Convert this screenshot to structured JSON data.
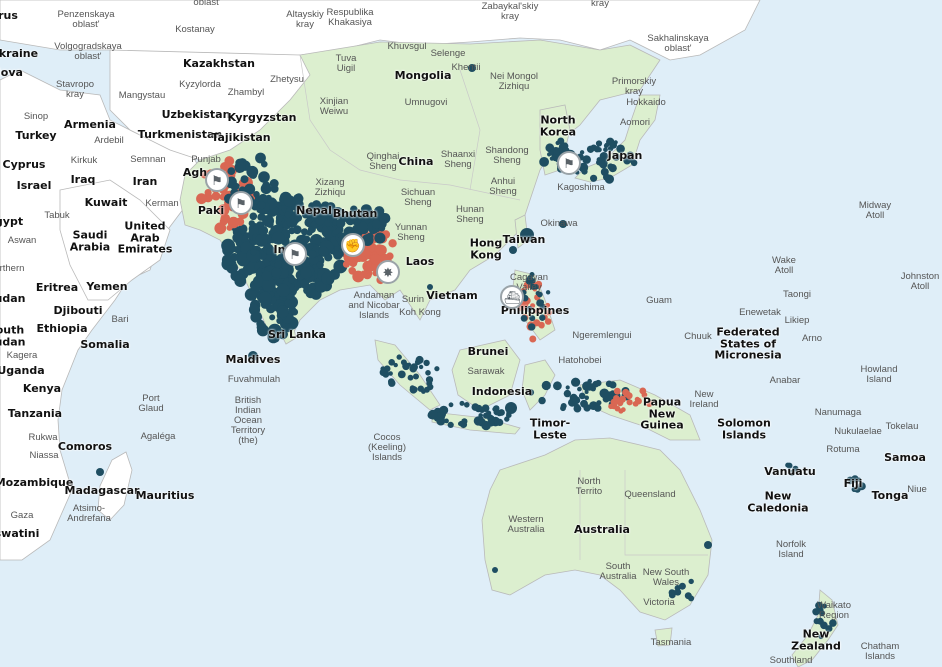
{
  "colors": {
    "ocean": "#dfeef8",
    "land_highlight": "#dcefcf",
    "land_other": "#ffffff",
    "border": "#b9b9b9",
    "event_blue": "#1f4e62",
    "event_red": "#d96753",
    "marker_border": "#9aa3a8"
  },
  "country_labels": [
    {
      "id": "russia-w",
      "text": "rus"
    },
    {
      "id": "ukraine",
      "text": "Ukraine"
    },
    {
      "id": "moldova",
      "text": "lova"
    },
    {
      "id": "kazakhstan",
      "text": "Kazakhstan"
    },
    {
      "id": "mongolia",
      "text": "Mongolia"
    },
    {
      "id": "armenia",
      "text": "Armenia"
    },
    {
      "id": "turkey",
      "text": "Turkey"
    },
    {
      "id": "cyprus",
      "text": "Cyprus"
    },
    {
      "id": "turkmenistan",
      "text": "Turkmenistan"
    },
    {
      "id": "uzbekistan",
      "text": "Uzbekistan"
    },
    {
      "id": "kyrgyzstan",
      "text": "Kyrgyzstan"
    },
    {
      "id": "tajikistan",
      "text": "Tajikistan"
    },
    {
      "id": "north-korea",
      "text": "North\nKorea"
    },
    {
      "id": "japan",
      "text": "Japan"
    },
    {
      "id": "china",
      "text": "China"
    },
    {
      "id": "israel",
      "text": "Israel"
    },
    {
      "id": "iraq",
      "text": "Iraq"
    },
    {
      "id": "iran",
      "text": "Iran"
    },
    {
      "id": "kuwait",
      "text": "Kuwait"
    },
    {
      "id": "egypt",
      "text": "gypt"
    },
    {
      "id": "saudi-arabia",
      "text": "Saudi\nArabia"
    },
    {
      "id": "uae",
      "text": "United\nArab\nEmirates"
    },
    {
      "id": "afghanistan",
      "text": "Agh"
    },
    {
      "id": "pakistan",
      "text": "Paki"
    },
    {
      "id": "nepal",
      "text": "Nepal"
    },
    {
      "id": "bhutan",
      "text": "Bhutan"
    },
    {
      "id": "india",
      "text": "India"
    },
    {
      "id": "taiwan",
      "text": "Taiwan"
    },
    {
      "id": "hong-kong",
      "text": "Hong\nKong"
    },
    {
      "id": "laos",
      "text": "Laos"
    },
    {
      "id": "vietnam",
      "text": "Vietnam"
    },
    {
      "id": "philippines",
      "text": "Philippines"
    },
    {
      "id": "eritrea",
      "text": "Eritrea"
    },
    {
      "id": "yemen",
      "text": "Yemen"
    },
    {
      "id": "djibouti",
      "text": "Djibouti"
    },
    {
      "id": "sudan",
      "text": "udan"
    },
    {
      "id": "south-sudan",
      "text": "outh\nudan"
    },
    {
      "id": "ethiopia",
      "text": "Ethiopia"
    },
    {
      "id": "somalia",
      "text": "Somalia"
    },
    {
      "id": "sri-lanka",
      "text": "Sri Lanka"
    },
    {
      "id": "maldives",
      "text": "Maldives"
    },
    {
      "id": "uganda",
      "text": "Uganda"
    },
    {
      "id": "kenya",
      "text": "Kenya"
    },
    {
      "id": "tanzania",
      "text": "Tanzania"
    },
    {
      "id": "brunei",
      "text": "Brunei"
    },
    {
      "id": "indonesia",
      "text": "Indonesia"
    },
    {
      "id": "timor-leste",
      "text": "Timor-\nLeste"
    },
    {
      "id": "papua-new-guinea",
      "text": "Papua\nNew\nGuinea"
    },
    {
      "id": "solomon-islands",
      "text": "Solomon\nIslands"
    },
    {
      "id": "micronesia",
      "text": "Federated\nStates of\nMicronesia"
    },
    {
      "id": "comoros",
      "text": "Comoros"
    },
    {
      "id": "mozambique",
      "text": "Mozambique"
    },
    {
      "id": "madagascar",
      "text": "Madagascar"
    },
    {
      "id": "mauritius",
      "text": "Mauritius"
    },
    {
      "id": "eswatini",
      "text": "swatini"
    },
    {
      "id": "australia",
      "text": "Australia"
    },
    {
      "id": "vanuatu",
      "text": "Vanuatu"
    },
    {
      "id": "fiji",
      "text": "Fiji"
    },
    {
      "id": "samoa",
      "text": "Samoa"
    },
    {
      "id": "tonga",
      "text": "Tonga"
    },
    {
      "id": "new-caledonia",
      "text": "New\nCaledonia"
    },
    {
      "id": "new-zealand",
      "text": "New\nZealand"
    }
  ],
  "region_labels": [
    {
      "id": "penzenskaya",
      "text": "Penzenskaya\noblast'"
    },
    {
      "id": "oblast-top",
      "text": "oblast'"
    },
    {
      "id": "altayskiy",
      "text": "Altayskiy\nkray"
    },
    {
      "id": "khakasiya",
      "text": "Respublika\nKhakasiya"
    },
    {
      "id": "zabaykalskiy",
      "text": "Zabaykal'skiy\nkray"
    },
    {
      "id": "kray-top",
      "text": "kray"
    },
    {
      "id": "sakhalinskaya",
      "text": "Sakhalinskaya\noblast'"
    },
    {
      "id": "volgogradskaya",
      "text": "Volgogradskaya\noblast'"
    },
    {
      "id": "kostanay",
      "text": "Kostanay"
    },
    {
      "id": "tuva",
      "text": "Tuva\nUigil"
    },
    {
      "id": "khuvsgul",
      "text": "Khuvsgul"
    },
    {
      "id": "selenge",
      "text": "Selenge"
    },
    {
      "id": "khentii",
      "text": "Khentii"
    },
    {
      "id": "nei-mongol",
      "text": "Nei Mongol\nZizhiqu"
    },
    {
      "id": "primorskiy",
      "text": "Primorskiy\nkray"
    },
    {
      "id": "stavropol",
      "text": "Stavropo\nkray"
    },
    {
      "id": "mangystau",
      "text": "Mangystau"
    },
    {
      "id": "kyzylorda",
      "text": "Kyzylorda"
    },
    {
      "id": "zhambyl",
      "text": "Zhambyl"
    },
    {
      "id": "zhetysu",
      "text": "Zhetysu"
    },
    {
      "id": "xinjiang",
      "text": "Xinjian\nWeiwu"
    },
    {
      "id": "umnugovi",
      "text": "Umnugovi"
    },
    {
      "id": "hokkaido",
      "text": "Hokkaido"
    },
    {
      "id": "aomori",
      "text": "Aomori"
    },
    {
      "id": "ardebil",
      "text": "Ardebil"
    },
    {
      "id": "sinop",
      "text": "Sinop"
    },
    {
      "id": "kirkuk",
      "text": "Kirkuk"
    },
    {
      "id": "semnan",
      "text": "Semnan"
    },
    {
      "id": "qinghai",
      "text": "Qinghai\nSheng"
    },
    {
      "id": "shaanxi",
      "text": "Shaanxi\nSheng"
    },
    {
      "id": "shandong",
      "text": "Shandong\nSheng"
    },
    {
      "id": "anhui",
      "text": "Anhui\nSheng"
    },
    {
      "id": "xizang",
      "text": "Xizang\nZizhiqu"
    },
    {
      "id": "sichuan",
      "text": "Sichuan\nSheng"
    },
    {
      "id": "hunan",
      "text": "Hunan\nSheng"
    },
    {
      "id": "yunnan",
      "text": "Yunnan\nSheng"
    },
    {
      "id": "kerman",
      "text": "Kerman"
    },
    {
      "id": "tabuk",
      "text": "Tabuk"
    },
    {
      "id": "aswan",
      "text": "Aswan"
    },
    {
      "id": "kagoshima",
      "text": "Kagoshima"
    },
    {
      "id": "okinawa",
      "text": "Okinawa"
    },
    {
      "id": "cagayan",
      "text": "Cagayan\nValley"
    },
    {
      "id": "andaman",
      "text": "Andaman\nand Nicobar\nIslands"
    },
    {
      "id": "northern",
      "text": "rthern"
    },
    {
      "id": "bari",
      "text": "Bari"
    },
    {
      "id": "ngeremlengui",
      "text": "Ngeremlengui"
    },
    {
      "id": "hatohobei",
      "text": "Hatohobei"
    },
    {
      "id": "fuvahmulah",
      "text": "Fuvahmulah"
    },
    {
      "id": "biot",
      "text": "British\nIndian\nOcean\nTerritory\n(the)"
    },
    {
      "id": "cocos",
      "text": "Cocos\n(Keeling)\nIslands"
    },
    {
      "id": "rukwa",
      "text": "Rukwa"
    },
    {
      "id": "niassa",
      "text": "Niassa"
    },
    {
      "id": "gaza",
      "text": "Gaza"
    },
    {
      "id": "atsimo",
      "text": "Atsimo-\nAndrefana"
    },
    {
      "id": "northern-territory",
      "text": "North\nTerrito"
    },
    {
      "id": "queensland",
      "text": "Queensland"
    },
    {
      "id": "western-australia",
      "text": "Western\nAustralia"
    },
    {
      "id": "south-australia",
      "text": "South\nAustralia"
    },
    {
      "id": "nsw",
      "text": "New South\nWales"
    },
    {
      "id": "victoria",
      "text": "Victoria"
    },
    {
      "id": "tasmania",
      "text": "Tasmania"
    },
    {
      "id": "guam",
      "text": "Guam"
    },
    {
      "id": "midway",
      "text": "Midway\nAtoll"
    },
    {
      "id": "wake",
      "text": "Wake\nAtoll"
    },
    {
      "id": "johnston",
      "text": "Johnston\nAtoll"
    },
    {
      "id": "enewetak",
      "text": "Enewetak"
    },
    {
      "id": "taongi",
      "text": "Taongi"
    },
    {
      "id": "likiep",
      "text": "Likiep"
    },
    {
      "id": "chuuk",
      "text": "Chuuk"
    },
    {
      "id": "arno",
      "text": "Arno"
    },
    {
      "id": "anabar",
      "text": "Anabar"
    },
    {
      "id": "howland",
      "text": "Howland\nIsland"
    },
    {
      "id": "new-ireland",
      "text": "New\nIreland"
    },
    {
      "id": "nanumaga",
      "text": "Nanumaga"
    },
    {
      "id": "nukulaelae",
      "text": "Nukulaelae"
    },
    {
      "id": "tokelau",
      "text": "Tokelau"
    },
    {
      "id": "rotuma",
      "text": "Rotuma"
    },
    {
      "id": "niue",
      "text": "Niue"
    },
    {
      "id": "norfolk",
      "text": "Norfolk\nIsland"
    },
    {
      "id": "waikato",
      "text": "Waikato\nRegion"
    },
    {
      "id": "chatham",
      "text": "Chatham\nIslands"
    },
    {
      "id": "southland",
      "text": "Southland"
    },
    {
      "id": "kagera",
      "text": "Kagera"
    },
    {
      "id": "port-glaud",
      "text": "Port\nGlaud"
    },
    {
      "id": "agalega",
      "text": "Agaléga"
    },
    {
      "id": "sarawak",
      "text": "Sarawak"
    },
    {
      "id": "koh-kong",
      "text": "Koh Kong"
    },
    {
      "id": "surin",
      "text": "Surin"
    },
    {
      "id": "punjab",
      "text": "Punjab"
    }
  ],
  "markers": [
    {
      "id": "cluster-afghanistan",
      "icon": "people-icon",
      "glyph": "⚑"
    },
    {
      "id": "cluster-pakistan",
      "icon": "people-icon",
      "glyph": "⚑"
    },
    {
      "id": "cluster-japan-sea",
      "icon": "people-icon",
      "glyph": "⚑"
    },
    {
      "id": "cluster-india-east",
      "icon": "people-icon",
      "glyph": "⚑"
    },
    {
      "id": "cluster-bangladesh",
      "icon": "protest-icon",
      "glyph": "✊"
    },
    {
      "id": "cluster-myanmar",
      "icon": "explosion-icon",
      "glyph": "✸"
    },
    {
      "id": "cluster-philippines",
      "icon": "ship-icon",
      "glyph": "⛴"
    }
  ]
}
